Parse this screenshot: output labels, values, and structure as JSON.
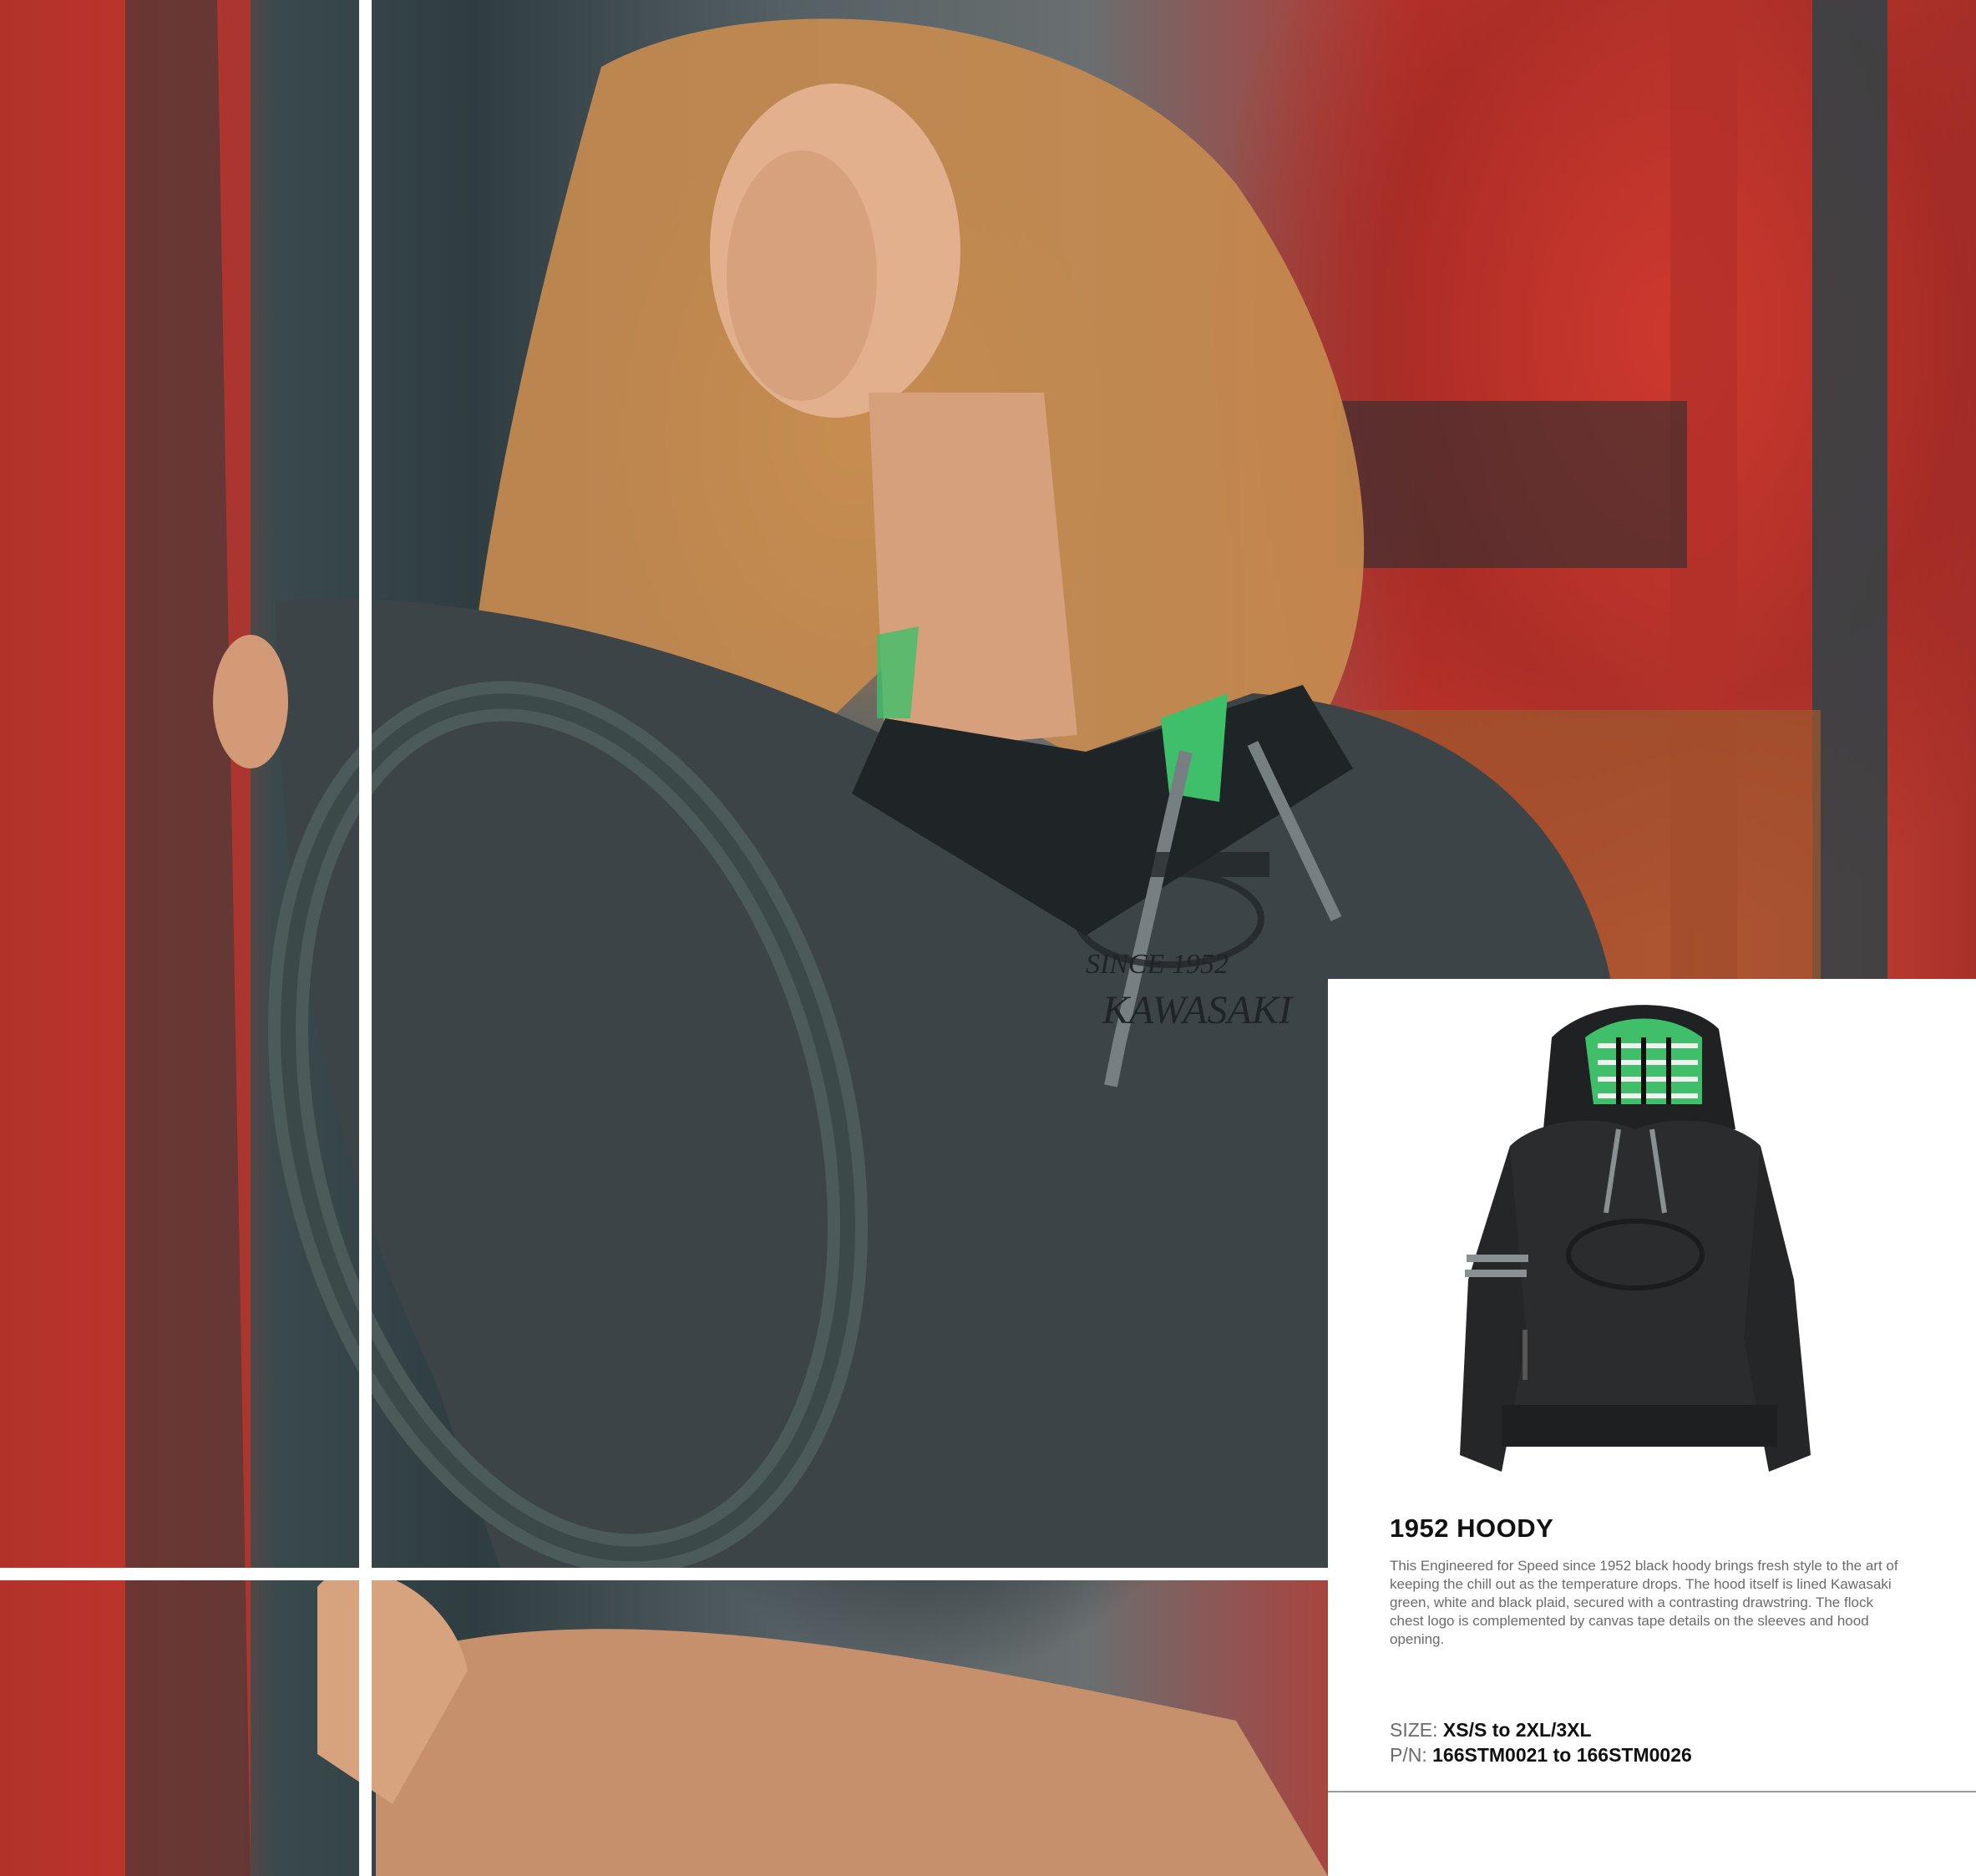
{
  "product": {
    "title": "1952 HOODY",
    "description": "This Engineered for Speed since 1952 black hoody brings fresh style to the art of keeping the chill out as the temperature drops. The hood itself is lined Kawasaki green, white and black plaid, secured with a contrasting drawstring. The flock chest logo is complemented by canvas tape details on the sleeves and hood opening.",
    "size_label": "SIZE:",
    "size_value": "XS/S to 2XL/3XL",
    "pn_label": "P/N:",
    "pn_value": "166STM0021 to 166STM0026"
  },
  "photo": {
    "chest_logo_text": "KAWASAKI",
    "chest_logo_since": "SINCE 1952"
  },
  "colors": {
    "truck_red": "#c4372f",
    "hoody_grey": "#3d4448",
    "lining_green": "#3fbf6a"
  }
}
